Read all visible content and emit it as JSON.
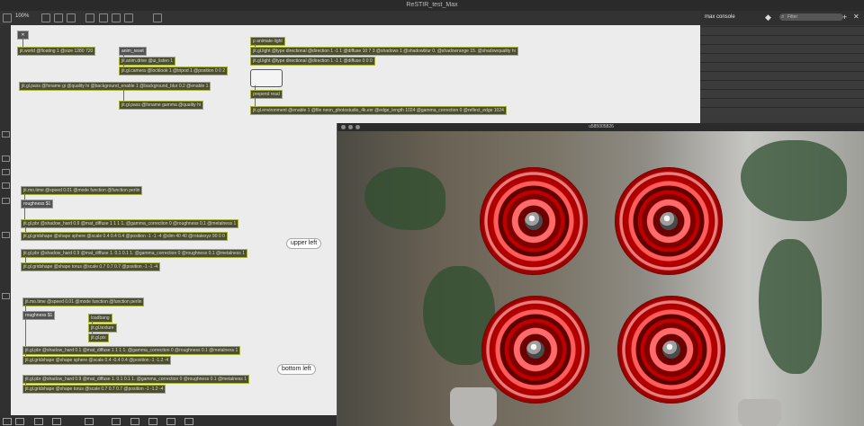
{
  "window": {
    "title": "ReSTIR_test_Max"
  },
  "toolbar": {
    "zoom": "100%"
  },
  "console": {
    "title": "max console",
    "filter_placeholder": "Filter"
  },
  "patch": {
    "close_glyph": "✕",
    "objects": {
      "world": "jit.world @floating 1 @size 1280 720",
      "anim_reset": "anim_reset",
      "anim_drive": "jit.anim.drive @ui_listen 1",
      "camera": "jit.gl.camera @locklook 1 @tripod 1 @position 0 0 2",
      "pass_main": "jit.gl.pass @fxname gi @quality hi @background_enable 1 @background_blur 0.2 @enable 1",
      "pass_gamma": "jit.gl.pass @fxname gamma @quality hi",
      "animate_light": "p animate-light",
      "light1": "jit.gl.light @type directional @direction 1 -1 1 @diffuse 10 7 3 @shadows 1 @shadowblur 0. @shadowrange 15. @shadowquality hi",
      "light2": "jit.gl.light @type directional @direction 1 -1 1 @diffuse 0 0 0",
      "prepend_read": "prepend read",
      "environment": "jit.gl.environment @enable 1 @file neon_photostudio_4k.exr @edge_length 1024 @gamma_correction 0 @reflect_edge 1024",
      "mo_time1": "jit.mo.time @speed 0.01 @mode function @function perlin",
      "roughness1": "roughness $1",
      "pbr1": "jit.gl.pbr @shadow_hard 0.9 @mat_diffuse 1 1 1 1. @gamma_correction 0 @roughness 0.1 @metalness 1",
      "grid1": "jit.gl.gridshape @shape sphere @scale 0.4 0.4 0.4 @position -1 -1 -4 @dim 40 40 @rotatexyz 90 0 0",
      "pbr2": "jit.gl.pbr @shadow_hard 0.9 @mat_diffuse 1. 0.1 0.1 1. @gamma_correction 0 @roughness 0.1 @metalness 1",
      "grid2": "jit.gl.gridshape @shape torus @scale 0.7 0.7 0.7 @position -1 -1 -4",
      "mo_time2": "jit.mo.time @speed 0.01 @mode function @function perlin",
      "roughness2": "roughness $1",
      "loadbang": "loadbang",
      "texture": "jit.gl.texture",
      "pix": "jit.gl.pix",
      "pbr3": "jit.gl.pbr @shadow_hard 0.1 @mat_diffuse 1 1 1 1. @gamma_correction 0 @roughness 0.1 @metalness 1",
      "grid3": "jit.gl.gridshape @shape sphere @scale 0.4 -0.4 0.4 @position -1 -1.2 -4",
      "pbr4": "jit.gl.pbr @shadow_hard 0.9 @mat_diffuse 1. 0.1 0.1 1. @gamma_correction 0 @roughness 0.1 @metalness 1",
      "grid4": "jit.gl.gridshape @shape torus @scale 0.7 0.7 0.7 @position -1 -1.2 -4"
    },
    "comments": {
      "upper_left": "upper left",
      "bottom_left": "bottom left"
    }
  },
  "viewer": {
    "title": "u585005826"
  },
  "colors": {
    "jit_object_border": "#a9b13d",
    "sphere_red": "#c00000",
    "canvas_bg": "#ececec"
  }
}
